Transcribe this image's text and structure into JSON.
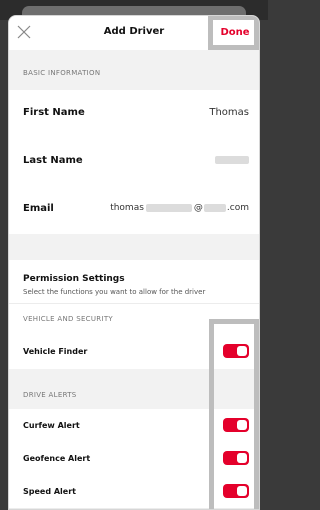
{
  "header": {
    "title": "Add Driver",
    "done_label": "Done"
  },
  "basic_info": {
    "section_label": "BASIC INFORMATION",
    "first_name_label": "First Name",
    "first_name_value": "Thomas",
    "last_name_label": "Last Name",
    "email_label": "Email",
    "email_prefix": "thomas",
    "email_at": "@",
    "email_suffix": ".com"
  },
  "permissions": {
    "title": "Permission Settings",
    "subtitle": "Select the functions you want to allow for the driver"
  },
  "vehicle_security": {
    "section_label": "VEHICLE AND SECURITY",
    "items": [
      {
        "label": "Vehicle Finder",
        "enabled": true
      }
    ]
  },
  "drive_alerts": {
    "section_label": "DRIVE ALERTS",
    "items": [
      {
        "label": "Curfew Alert",
        "enabled": true
      },
      {
        "label": "Geofence Alert",
        "enabled": true
      },
      {
        "label": "Speed Alert",
        "enabled": true
      }
    ]
  },
  "colors": {
    "accent": "#e4002b",
    "background": "#f2f2f2"
  }
}
